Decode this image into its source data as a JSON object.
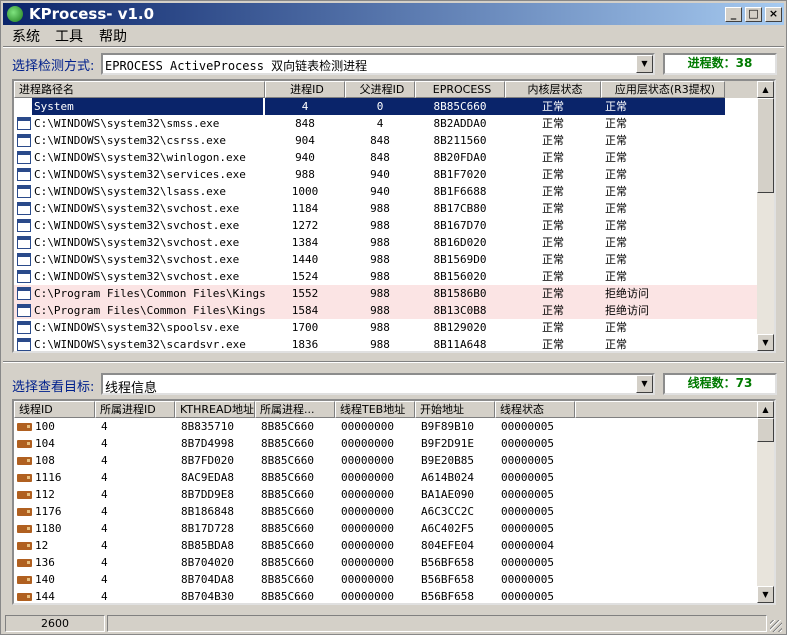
{
  "window": {
    "title": "KProcess- v1.0",
    "min": "_",
    "max": "□",
    "close": "×"
  },
  "menu": [
    "系统",
    "工具",
    "帮助"
  ],
  "top": {
    "label": "选择检测方式:",
    "method": "EPROCESS ActiveProcess 双向链表检测进程",
    "count": "进程数：38",
    "columns": [
      "进程路径名",
      "进程ID",
      "父进程ID",
      "EPROCESS",
      "内核层状态",
      "应用层状态(R3提权)"
    ],
    "rows": [
      [
        "System",
        "4",
        "0",
        "8B85C660",
        "正常",
        "正常"
      ],
      [
        "C:\\WINDOWS\\system32\\smss.exe",
        "848",
        "4",
        "8B2ADDA0",
        "正常",
        "正常"
      ],
      [
        "C:\\WINDOWS\\system32\\csrss.exe",
        "904",
        "848",
        "8B211560",
        "正常",
        "正常"
      ],
      [
        "C:\\WINDOWS\\system32\\winlogon.exe",
        "940",
        "848",
        "8B20FDA0",
        "正常",
        "正常"
      ],
      [
        "C:\\WINDOWS\\system32\\services.exe",
        "988",
        "940",
        "8B1F7020",
        "正常",
        "正常"
      ],
      [
        "C:\\WINDOWS\\system32\\lsass.exe",
        "1000",
        "940",
        "8B1F6688",
        "正常",
        "正常"
      ],
      [
        "C:\\WINDOWS\\system32\\svchost.exe",
        "1184",
        "988",
        "8B17CB80",
        "正常",
        "正常"
      ],
      [
        "C:\\WINDOWS\\system32\\svchost.exe",
        "1272",
        "988",
        "8B167D70",
        "正常",
        "正常"
      ],
      [
        "C:\\WINDOWS\\system32\\svchost.exe",
        "1384",
        "988",
        "8B16D020",
        "正常",
        "正常"
      ],
      [
        "C:\\WINDOWS\\system32\\svchost.exe",
        "1440",
        "988",
        "8B1569D0",
        "正常",
        "正常"
      ],
      [
        "C:\\WINDOWS\\system32\\svchost.exe",
        "1524",
        "988",
        "8B156020",
        "正常",
        "正常"
      ],
      [
        "C:\\Program Files\\Common Files\\Kings...",
        "1552",
        "988",
        "8B1586B0",
        "正常",
        "拒绝访问"
      ],
      [
        "C:\\Program Files\\Common Files\\Kings...",
        "1584",
        "988",
        "8B13C0B8",
        "正常",
        "拒绝访问"
      ],
      [
        "C:\\WINDOWS\\system32\\spoolsv.exe",
        "1700",
        "988",
        "8B129020",
        "正常",
        "正常"
      ],
      [
        "C:\\WINDOWS\\system32\\scardsvr.exe",
        "1836",
        "988",
        "8B11A648",
        "正常",
        "正常"
      ]
    ]
  },
  "bottom": {
    "label": "选择查看目标:",
    "target": "线程信息",
    "count": "线程数：73",
    "columns": [
      "线程ID",
      "所属进程ID",
      "KTHREAD地址",
      "所属进程...",
      "线程TEB地址",
      "开始地址",
      "线程状态"
    ],
    "rows": [
      [
        "100",
        "4",
        "8B835710",
        "8B85C660",
        "00000000",
        "B9F89B10",
        "00000005"
      ],
      [
        "104",
        "4",
        "8B7D4998",
        "8B85C660",
        "00000000",
        "B9F2D91E",
        "00000005"
      ],
      [
        "108",
        "4",
        "8B7FD020",
        "8B85C660",
        "00000000",
        "B9E20B85",
        "00000005"
      ],
      [
        "1116",
        "4",
        "8AC9EDA8",
        "8B85C660",
        "00000000",
        "A614B024",
        "00000005"
      ],
      [
        "112",
        "4",
        "8B7DD9E8",
        "8B85C660",
        "00000000",
        "BA1AE090",
        "00000005"
      ],
      [
        "1176",
        "4",
        "8B186848",
        "8B85C660",
        "00000000",
        "A6C3CC2C",
        "00000005"
      ],
      [
        "1180",
        "4",
        "8B17D728",
        "8B85C660",
        "00000000",
        "A6C402F5",
        "00000005"
      ],
      [
        "12",
        "4",
        "8B85BDA8",
        "8B85C660",
        "00000000",
        "804EFE04",
        "00000004"
      ],
      [
        "136",
        "4",
        "8B704020",
        "8B85C660",
        "00000000",
        "B56BF658",
        "00000005"
      ],
      [
        "140",
        "4",
        "8B704DA8",
        "8B85C660",
        "00000000",
        "B56BF658",
        "00000005"
      ],
      [
        "144",
        "4",
        "8B704B30",
        "8B85C660",
        "00000000",
        "B56BF658",
        "00000005"
      ]
    ]
  },
  "status": {
    "left": "2600",
    "right": ""
  }
}
